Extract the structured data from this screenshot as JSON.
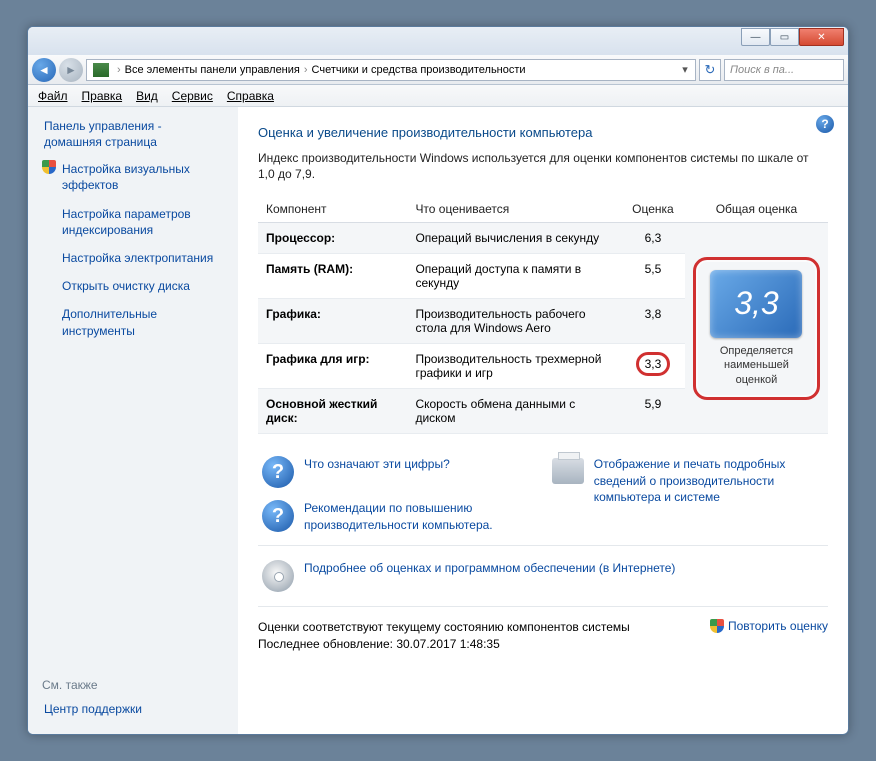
{
  "titlebar": {
    "min": "—",
    "max": "▭",
    "close": "✕"
  },
  "nav": {
    "back": "◄",
    "fwd": "►",
    "bc1": "Все элементы панели управления",
    "bc2": "Счетчики и средства производительности",
    "sep": "›",
    "drop": "▾",
    "refresh": "↻",
    "search_ph": "Поиск в па..."
  },
  "menu": {
    "file": "Файл",
    "edit": "Правка",
    "view": "Вид",
    "tools": "Сервис",
    "help": "Справка"
  },
  "sidebar": {
    "home1": "Панель управления -",
    "home2": "домашняя страница",
    "visual": "Настройка визуальных эффектов",
    "indexing": "Настройка параметров индексирования",
    "power": "Настройка электропитания",
    "disk": "Открыть очистку диска",
    "tools": "Дополнительные инструменты",
    "see_also": "См. также",
    "support": "Центр поддержки"
  },
  "content": {
    "help": "?",
    "h1": "Оценка и увеличение производительности компьютера",
    "desc": "Индекс производительности Windows используется для оценки компонентов системы по шкале от 1,0 до 7,9.",
    "th_component": "Компонент",
    "th_what": "Что оценивается",
    "th_score": "Оценка",
    "th_overall": "Общая оценка",
    "rows": {
      "r0_c": "Процессор:",
      "r0_w": "Операций вычисления в секунду",
      "r0_s": "6,3",
      "r1_c": "Память (RAM):",
      "r1_w": "Операций доступа к памяти в секунду",
      "r1_s": "5,5",
      "r2_c": "Графика:",
      "r2_w": "Производительность рабочего стола для Windows Aero",
      "r2_s": "3,8",
      "r3_c": "Графика для игр:",
      "r3_w": "Производительность трехмерной графики и игр",
      "r3_s": "3,3",
      "r4_c": "Основной жесткий диск:",
      "r4_w": "Скорость обмена данными с диском",
      "r4_s": "5,9"
    },
    "overall_score": "3,3",
    "overall_label": "Определяется наименьшей оценкой",
    "link_q1": "Что означают эти цифры?",
    "link_q2": "Рекомендации по повышению производительности компьютера.",
    "link_print": "Отображение и печать подробных сведений о производительности компьютера и системе",
    "link_more": "Подробнее об оценках и программном обеспечении (в Интернете)",
    "status1": "Оценки соответствуют текущему состоянию компонентов системы",
    "status2": "Последнее обновление: 30.07.2017 1:48:35",
    "rerun": "Повторить оценку",
    "q": "?"
  }
}
